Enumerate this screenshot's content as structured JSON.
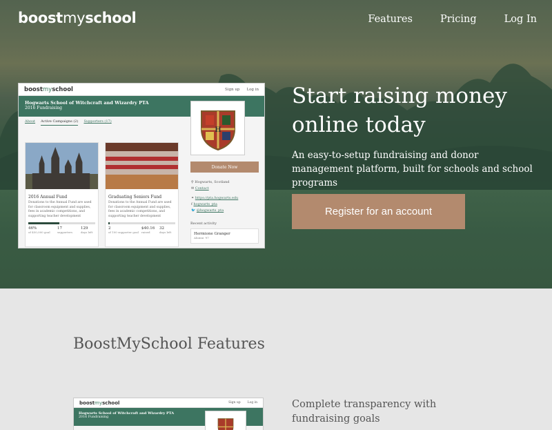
{
  "brand": {
    "bold1": "boost",
    "lite": "my",
    "bold2": "school"
  },
  "nav": [
    {
      "label": "Features"
    },
    {
      "label": "Pricing"
    },
    {
      "label": "Log In"
    }
  ],
  "hero": {
    "headline": "Start raising money online today",
    "subtext": "An easy-to-setup fundraising and donor management platform, built for schools and school programs",
    "cta": "Register for an account"
  },
  "mockup": {
    "logo_a": "boost",
    "logo_b": "my",
    "logo_c": "school",
    "links": [
      "Sign up",
      "Log in"
    ],
    "org": "Hogwarts School of Witchcraft and Wizardry PTA",
    "campaign": "2016 Fundraising",
    "tabs": [
      "About",
      "Active Campaigns (2)",
      "Supporters (17)"
    ],
    "donate": "Donate Now",
    "location": "Hogwarts, Scotland",
    "contact": "Contact",
    "website": "https://pta.hogwarts.edu",
    "facebook": "hogwarts_pta",
    "twitter": "@hogwarts_pta",
    "recent_label": "Recent activity",
    "recent_name": "Hermione Granger",
    "recent_sub": "Alumni '97",
    "cards": [
      {
        "title": "2016 Annual Fund",
        "desc": "Donations to the Annual Fund are used for classroom equipment and supplies, fees in academic competitions, and supporting teacher development",
        "progress": 0.46,
        "stats": [
          {
            "v": "46%",
            "l": "of $50,000 goal"
          },
          {
            "v": "17",
            "l": "supporters"
          },
          {
            "v": "129",
            "l": "days left"
          }
        ]
      },
      {
        "title": "Graduating Seniors Fund",
        "desc": "Donations to the Annual Fund are used for classroom equipment and supplies, fees in academic competitions, and supporting teacher development",
        "progress": 0.02,
        "stats": [
          {
            "v": "2",
            "l": "of 100 supporter goal"
          },
          {
            "v": "$40.16",
            "l": "raised"
          },
          {
            "v": "32",
            "l": "days left"
          }
        ]
      }
    ]
  },
  "features": {
    "title": "BoostMySchool Features",
    "first_heading": "Complete transparency with fundraising goals"
  },
  "colors": {
    "accent": "#b38a6e",
    "brand_green": "#3d7561",
    "section_bg": "#e6e6e6"
  }
}
